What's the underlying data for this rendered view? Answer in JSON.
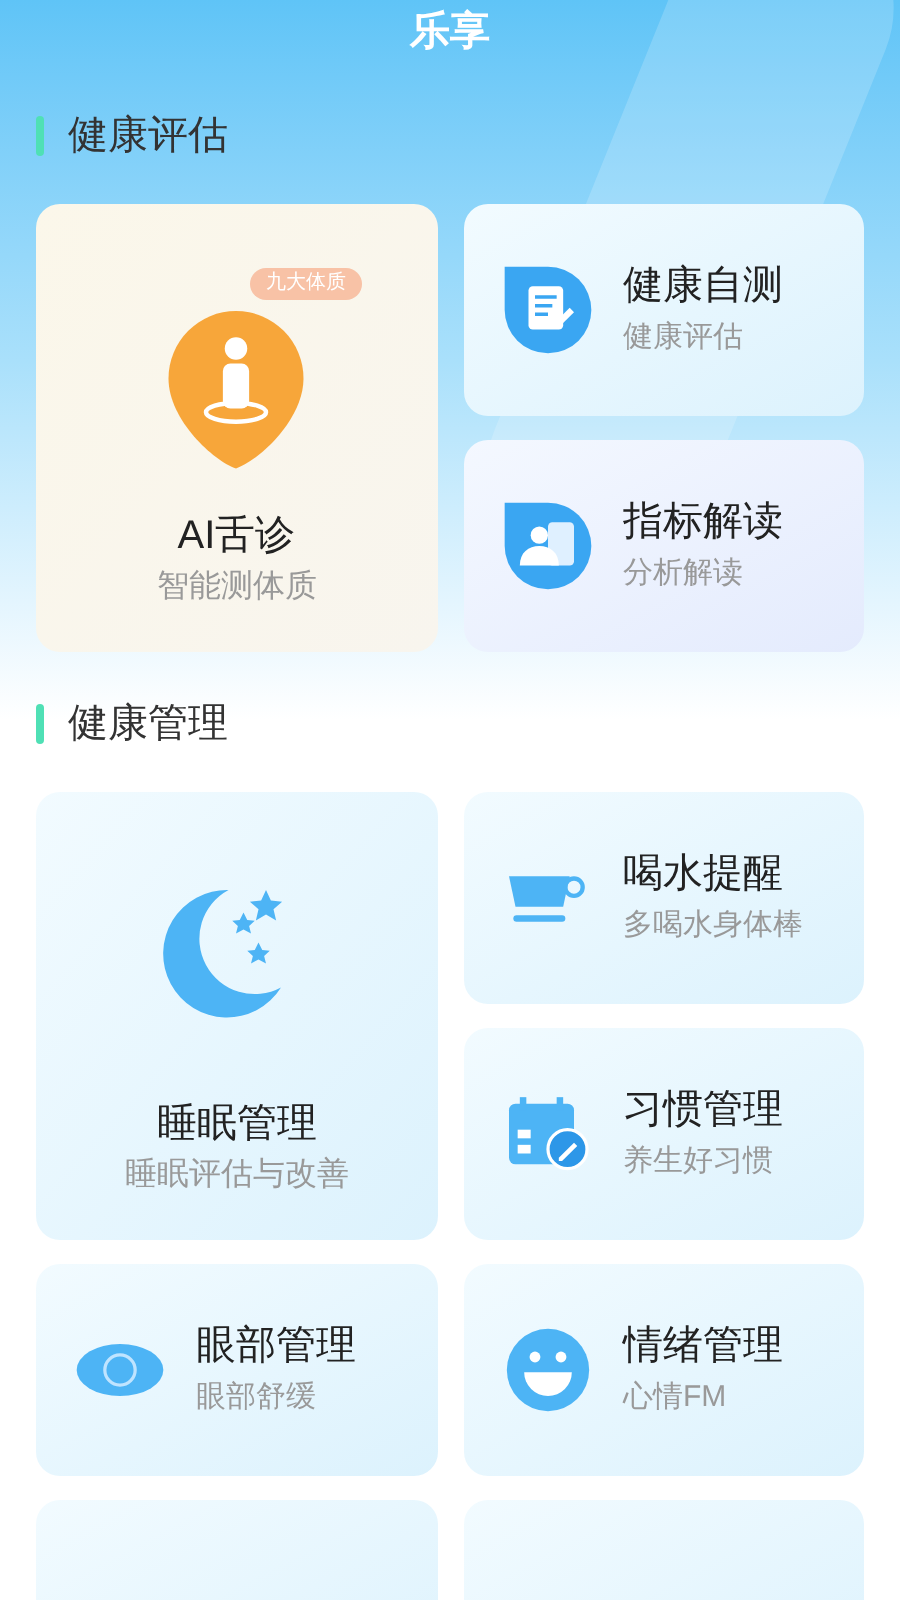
{
  "title": "乐享",
  "sections": [
    {
      "heading": "健康评估",
      "cards": [
        {
          "kind": "tall",
          "title": "AI舌诊",
          "subtitle": "智能测体质",
          "badge": "九大体质"
        },
        {
          "kind": "wide",
          "title": "健康自测",
          "subtitle": "健康评估"
        },
        {
          "kind": "wide",
          "title": "指标解读",
          "subtitle": "分析解读"
        }
      ]
    },
    {
      "heading": "健康管理",
      "cards": [
        {
          "kind": "tall",
          "title": "睡眠管理",
          "subtitle": "睡眠评估与改善"
        },
        {
          "kind": "wide",
          "title": "喝水提醒",
          "subtitle": "多喝水身体棒"
        },
        {
          "kind": "wide",
          "title": "习惯管理",
          "subtitle": "养生好习惯"
        },
        {
          "kind": "wide",
          "title": "眼部管理",
          "subtitle": "眼部舒缓"
        },
        {
          "kind": "wide",
          "title": "情绪管理",
          "subtitle": "心情FM"
        },
        {
          "kind": "stub"
        },
        {
          "kind": "stub"
        }
      ]
    }
  ]
}
